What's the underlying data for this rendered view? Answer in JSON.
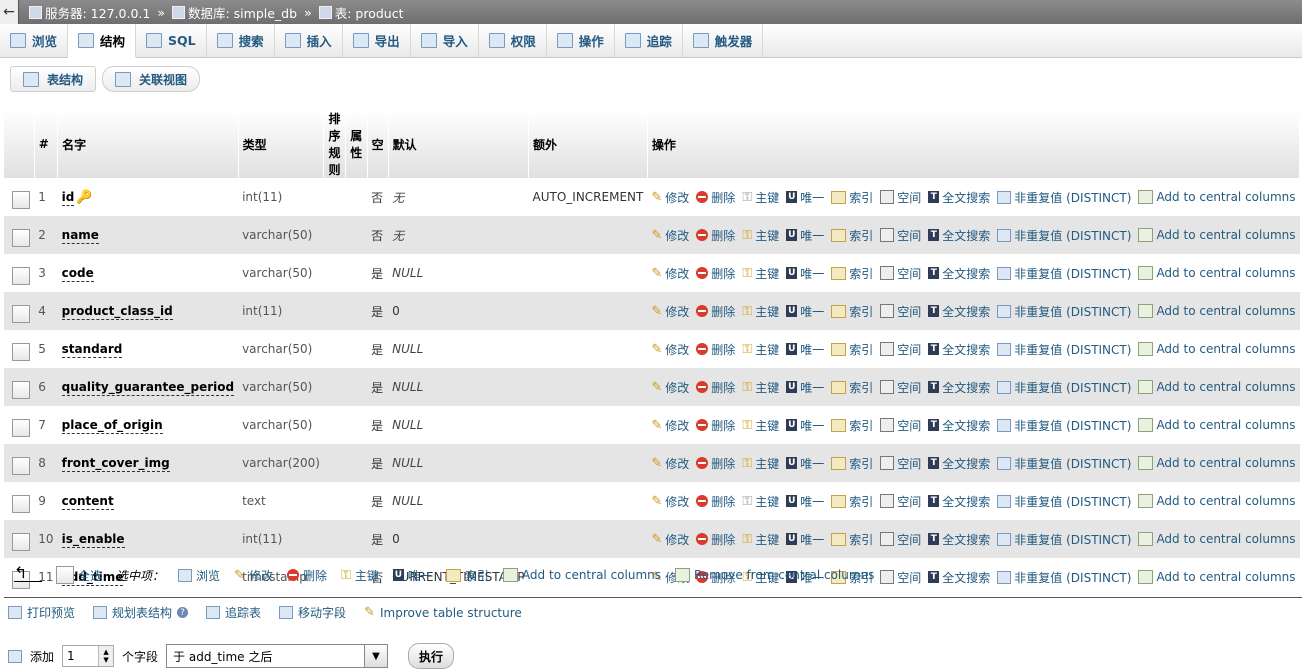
{
  "breadcrumb": {
    "server": "服务器: 127.0.0.1",
    "database": "数据库: simple_db",
    "table": "表: product",
    "sep": "»"
  },
  "tabs": [
    "浏览",
    "结构",
    "SQL",
    "搜索",
    "插入",
    "导出",
    "导入",
    "权限",
    "操作",
    "追踪",
    "触发器"
  ],
  "subtabs": [
    "表结构",
    "关联视图"
  ],
  "headers": {
    "num": "#",
    "name": "名字",
    "type": "类型",
    "collation": "排序规则",
    "attributes": "属性",
    "null": "空",
    "default": "默认",
    "extra": "额外",
    "action": "操作"
  },
  "actions": {
    "edit": "修改",
    "drop": "删除",
    "primary": "主键",
    "unique": "唯一",
    "index": "索引",
    "spatial": "空间",
    "fulltext": "全文搜索",
    "distinct": "非重复值 (DISTINCT)",
    "central": "Add to central columns"
  },
  "rows": [
    {
      "num": "1",
      "name": "id",
      "type": "int(11)",
      "null": "否",
      "default": "无",
      "extra": "AUTO_INCREMENT"
    },
    {
      "num": "2",
      "name": "name",
      "type": "varchar(50)",
      "null": "否",
      "default": "无",
      "extra": ""
    },
    {
      "num": "3",
      "name": "code",
      "type": "varchar(50)",
      "null": "是",
      "default": "NULL",
      "extra": ""
    },
    {
      "num": "4",
      "name": "product_class_id",
      "type": "int(11)",
      "null": "是",
      "default": "0",
      "extra": ""
    },
    {
      "num": "5",
      "name": "standard",
      "type": "varchar(50)",
      "null": "是",
      "default": "NULL",
      "extra": ""
    },
    {
      "num": "6",
      "name": "quality_guarantee_period",
      "type": "varchar(50)",
      "null": "是",
      "default": "NULL",
      "extra": ""
    },
    {
      "num": "7",
      "name": "place_of_origin",
      "type": "varchar(50)",
      "null": "是",
      "default": "NULL",
      "extra": ""
    },
    {
      "num": "8",
      "name": "front_cover_img",
      "type": "varchar(200)",
      "null": "是",
      "default": "NULL",
      "extra": ""
    },
    {
      "num": "9",
      "name": "content",
      "type": "text",
      "null": "是",
      "default": "NULL",
      "extra": ""
    },
    {
      "num": "10",
      "name": "is_enable",
      "type": "int(11)",
      "null": "是",
      "default": "0",
      "extra": ""
    },
    {
      "num": "11",
      "name": "add_time",
      "type": "timestamp",
      "null": "否",
      "default": "CURRENT_TIMESTAMP",
      "extra": ""
    }
  ],
  "bulk": {
    "check_all": "全选",
    "with_selected": "选中项：",
    "browse": "浏览",
    "edit": "修改",
    "drop": "删除",
    "primary": "主键",
    "unique": "唯一",
    "index": "索引",
    "add_central": "Add to central columns",
    "remove_central": "Remove from central columns"
  },
  "links": {
    "print": "打印预览",
    "propose": "规划表结构",
    "track": "追踪表",
    "move": "移动字段",
    "improve": "Improve table structure"
  },
  "add": {
    "label": "添加",
    "count": "1",
    "unit": "个字段",
    "position": "于 add_time 之后",
    "go": "执行"
  }
}
